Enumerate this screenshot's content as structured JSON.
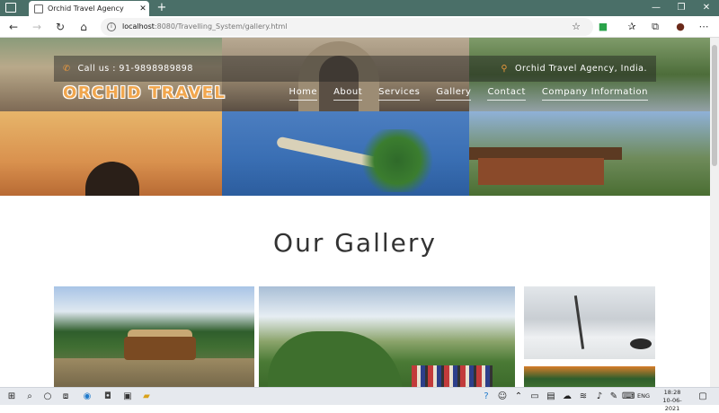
{
  "browser": {
    "tab_title": "Orchid Travel Agency",
    "tab_close": "✕",
    "new_tab": "+",
    "url_host": "localhost",
    "url_path": ":8080/Travelling_System/gallery.html",
    "window_controls": [
      "—",
      "❐",
      "✕"
    ],
    "icons": [
      "back-icon",
      "forward-icon",
      "reload-icon",
      "home-icon",
      "favorite-star-icon",
      "extension-icon",
      "favorites-icon",
      "collections-icon",
      "profile-icon",
      "more-icon"
    ]
  },
  "site": {
    "call": "Call us : 91-9898989898",
    "location": "Orchid Travel Agency, India.",
    "brand": "ORCHID TRAVEL",
    "menu": [
      "Home",
      "About",
      "Services",
      "Gallery",
      "Contact",
      "Company Information"
    ],
    "gallery_title": "Our Gallery",
    "accent_color": "#f0a64e"
  },
  "taskbar": {
    "lang": "ENG",
    "time": "18:28",
    "date": "10-06-2021"
  }
}
